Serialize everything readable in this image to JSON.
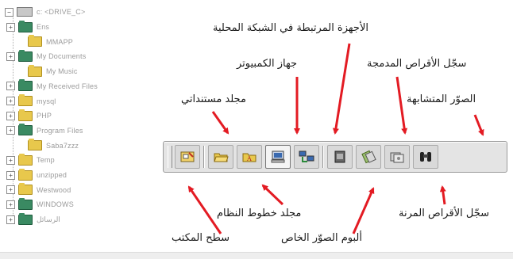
{
  "tree": {
    "root_label": "c: <DRIVE_C>",
    "items": [
      {
        "label": "Ens",
        "expand": "+",
        "color": "green"
      },
      {
        "label": "MMAPP",
        "expand": "",
        "color": "yellow"
      },
      {
        "label": "My Documents",
        "expand": "+",
        "color": "green"
      },
      {
        "label": "My Music",
        "expand": "",
        "color": "yellow"
      },
      {
        "label": "My Received Files",
        "expand": "+",
        "color": "green"
      },
      {
        "label": "mysql",
        "expand": "+",
        "color": "yellow"
      },
      {
        "label": "PHP",
        "expand": "+",
        "color": "yellow"
      },
      {
        "label": "Program Files",
        "expand": "+",
        "color": "green"
      },
      {
        "label": "Saba7zzz",
        "expand": "",
        "color": "yellow"
      },
      {
        "label": "Temp",
        "expand": "+",
        "color": "yellow"
      },
      {
        "label": "unzipped",
        "expand": "+",
        "color": "yellow"
      },
      {
        "label": "Westwood",
        "expand": "+",
        "color": "yellow"
      },
      {
        "label": "WINDOWS",
        "expand": "+",
        "color": "green"
      },
      {
        "label": "الرسائل",
        "expand": "+",
        "color": "green"
      }
    ]
  },
  "toolbar": {
    "buttons": [
      {
        "name": "desktop-button",
        "icon": "desktop-icon"
      },
      {
        "name": "my-documents-button",
        "icon": "folder-open-icon"
      },
      {
        "name": "fonts-folder-button",
        "icon": "fonts-folder-icon"
      },
      {
        "name": "my-computer-button",
        "icon": "computer-icon",
        "selected": true
      },
      {
        "name": "network-button",
        "icon": "network-icon"
      },
      {
        "name": "photo-album-button",
        "icon": "photo-album-icon"
      },
      {
        "name": "removable-disks-button",
        "icon": "removable-disk-icon"
      },
      {
        "name": "cd-history-button",
        "icon": "cd-icon"
      },
      {
        "name": "similar-images-button",
        "icon": "binoculars-icon"
      }
    ]
  },
  "labels": {
    "network": "الأجهزة المرتبطة في الشبكة المحلية",
    "my_computer": "جهاز الكمبيوتر",
    "cd_history": "سجّل الأقراص المدمجة",
    "my_documents": "مجلد مستنداتي",
    "similar_images": "الصوّر المتشابهة",
    "fonts_folder": "مجلد خطوط النظام",
    "removable_disks": "سجّل الأقراص المرنة",
    "desktop": "سطح المكتب",
    "photo_album": "ألبوم الصوّر الخاص"
  },
  "colors": {
    "arrow": "#e31b23",
    "folder_yellow": "#e8c84c",
    "folder_green": "#3a8a62"
  }
}
